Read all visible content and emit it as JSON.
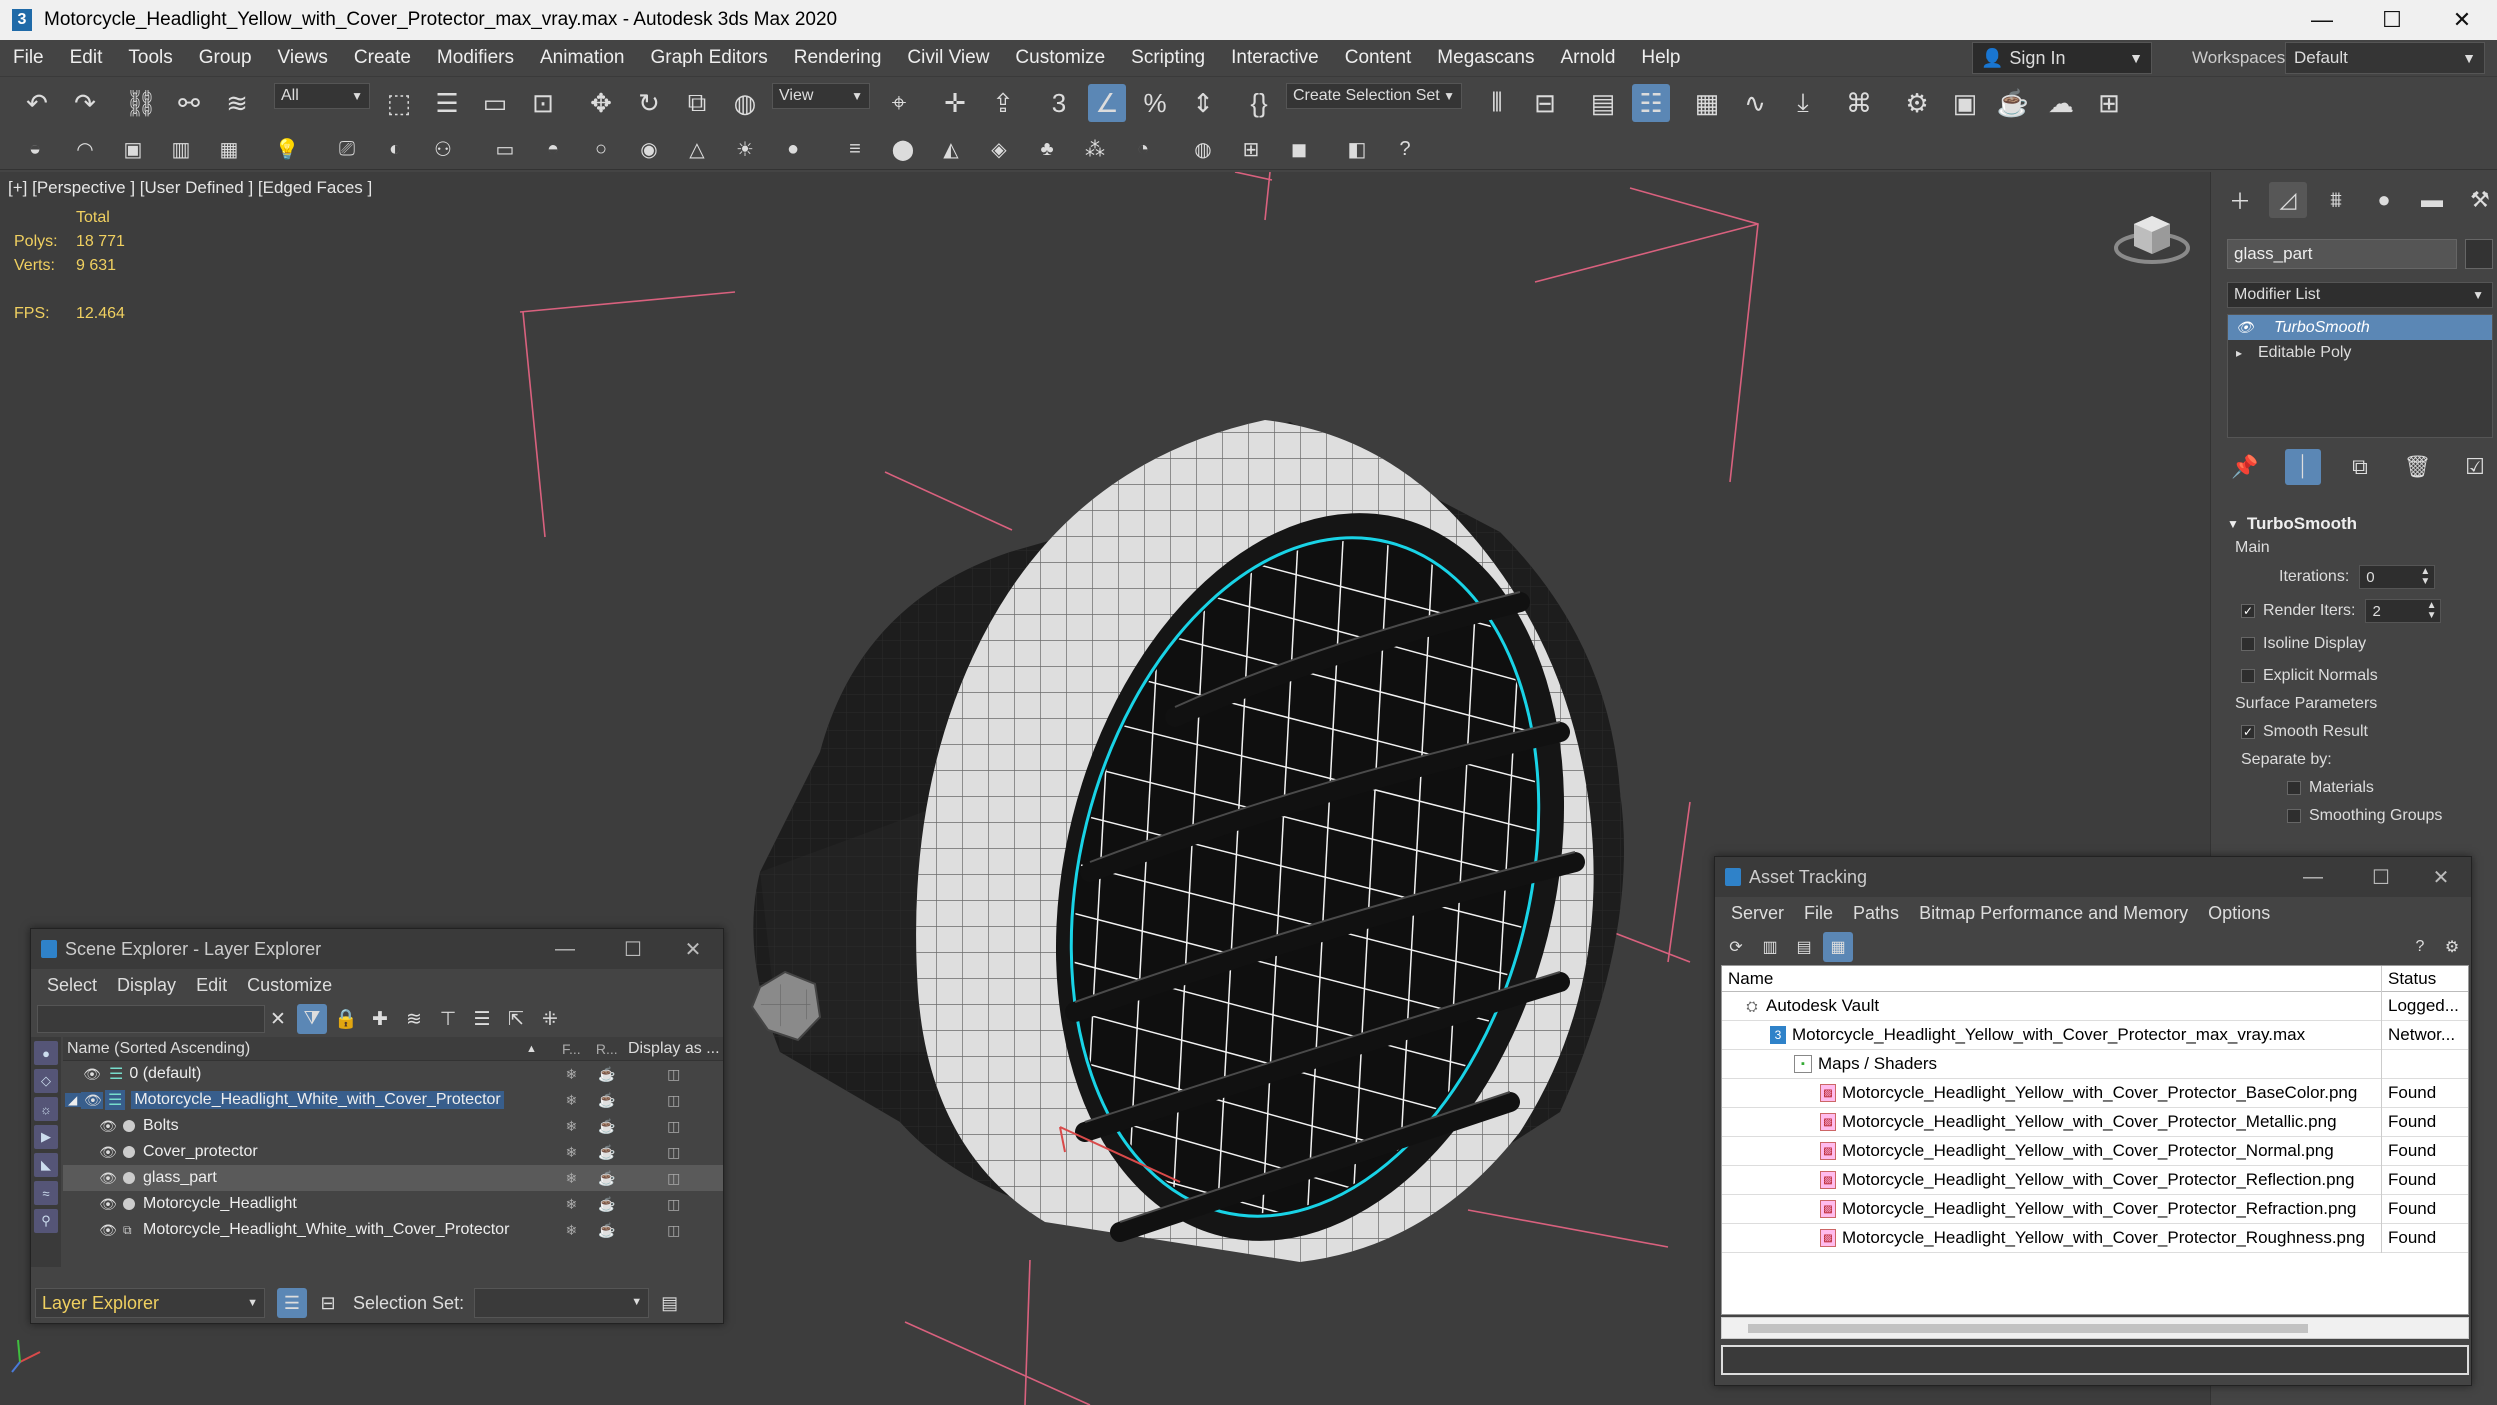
{
  "window": {
    "title": "Motorcycle_Headlight_Yellow_with_Cover_Protector_max_vray.max - Autodesk 3ds Max 2020",
    "app_icon": "3",
    "minimize": "—",
    "maximize": "☐",
    "close": "✕"
  },
  "menubar": {
    "items": [
      "File",
      "Edit",
      "Tools",
      "Group",
      "Views",
      "Create",
      "Modifiers",
      "Animation",
      "Graph Editors",
      "Rendering",
      "Civil View",
      "Customize",
      "Scripting",
      "Interactive",
      "Content",
      "Megascans",
      "Arnold",
      "Help"
    ],
    "sign_in": "Sign In",
    "workspaces_label": "Workspaces:",
    "workspaces_value": "Default"
  },
  "toolbar": {
    "selection_filter": "All",
    "reference_coord": "View",
    "selection_set": "Create Selection Set"
  },
  "viewport": {
    "label": "[+] [Perspective ] [User Defined ] [Edged Faces ]",
    "stats_total": "Total",
    "polys_label": "Polys:",
    "polys_value": "18 771",
    "verts_label": "Verts:",
    "verts_value": "9 631",
    "fps_label": "FPS:",
    "fps_value": "12.464"
  },
  "command_panel": {
    "object_name": "glass_part",
    "modifier_list": "Modifier List",
    "stack": [
      {
        "label": "TurboSmooth",
        "selected": true
      },
      {
        "label": "Editable Poly",
        "selected": false
      }
    ],
    "rollout_title": "TurboSmooth",
    "main_label": "Main",
    "iterations_label": "Iterations:",
    "iterations_value": "0",
    "render_iters_label": "Render Iters:",
    "render_iters_value": "2",
    "isoline_label": "Isoline Display",
    "explicit_normals_label": "Explicit Normals",
    "surface_params_label": "Surface Parameters",
    "smooth_result_label": "Smooth Result",
    "separate_by_label": "Separate by:",
    "materials_label": "Materials",
    "smoothing_groups_label": "Smoothing Groups"
  },
  "scene_explorer": {
    "title": "Scene Explorer - Layer Explorer",
    "menu": [
      "Select",
      "Display",
      "Edit",
      "Customize"
    ],
    "columns": {
      "name": "Name (Sorted Ascending)",
      "sort_arrow": "▲",
      "freeze": "F...",
      "render": "R...",
      "display": "Display as ..."
    },
    "rows": [
      {
        "label": "0 (default)",
        "indent": 1
      },
      {
        "label": "Motorcycle_Headlight_White_with_Cover_Protector",
        "indent": 0
      },
      {
        "label": "Bolts",
        "indent": 2
      },
      {
        "label": "Cover_protector",
        "indent": 2
      },
      {
        "label": "glass_part",
        "indent": 2
      },
      {
        "label": "Motorcycle_Headlight",
        "indent": 2
      },
      {
        "label": "Motorcycle_Headlight_White_with_Cover_Protector",
        "indent": 2
      }
    ],
    "layer_explorer": "Layer Explorer",
    "selection_set_label": "Selection Set:"
  },
  "asset_tracking": {
    "title": "Asset Tracking",
    "menu": [
      "Server",
      "File",
      "Paths",
      "Bitmap Performance and Memory",
      "Options"
    ],
    "col_name": "Name",
    "col_status": "Status",
    "rows": [
      {
        "name": "Autodesk Vault",
        "status": "Logged...",
        "type": "vault"
      },
      {
        "name": "Motorcycle_Headlight_Yellow_with_Cover_Protector_max_vray.max",
        "status": "Networ...",
        "type": "max"
      },
      {
        "name": "Maps / Shaders",
        "status": "",
        "type": "folder"
      },
      {
        "name": "Motorcycle_Headlight_Yellow_with_Cover_Protector_BaseColor.png",
        "status": "Found",
        "type": "file"
      },
      {
        "name": "Motorcycle_Headlight_Yellow_with_Cover_Protector_Metallic.png",
        "status": "Found",
        "type": "file"
      },
      {
        "name": "Motorcycle_Headlight_Yellow_with_Cover_Protector_Normal.png",
        "status": "Found",
        "type": "file"
      },
      {
        "name": "Motorcycle_Headlight_Yellow_with_Cover_Protector_Reflection.png",
        "status": "Found",
        "type": "file"
      },
      {
        "name": "Motorcycle_Headlight_Yellow_with_Cover_Protector_Refraction.png",
        "status": "Found",
        "type": "file"
      },
      {
        "name": "Motorcycle_Headlight_Yellow_with_Cover_Protector_Roughness.png",
        "status": "Found",
        "type": "file"
      }
    ]
  },
  "colors": {
    "accent": "#5b87b5",
    "stats_yellow": "#f0d060",
    "wire_cyan": "#19d3e6",
    "gizmo_pink": "#e05a7a"
  }
}
